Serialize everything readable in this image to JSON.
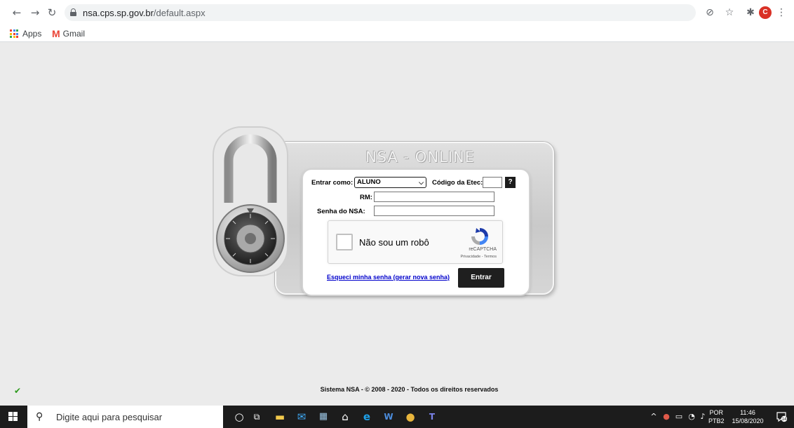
{
  "browser": {
    "url_host": "nsa.cps.sp.gov.br",
    "url_path": "/default.aspx",
    "profile_initial": "C",
    "bookmarks": [
      {
        "label": "Apps",
        "icon": "apps-grid-icon"
      },
      {
        "label": "Gmail",
        "icon": "gmail-icon"
      }
    ]
  },
  "login": {
    "title": "NSA - ONLINE",
    "enter_as_label": "Entrar como:",
    "enter_as_value": "ALUNO",
    "etec_code_label": "Código da Etec:",
    "etec_code_value": "",
    "help_label": "?",
    "rm_label": "RM:",
    "rm_value": "",
    "password_label": "Senha do NSA:",
    "password_value": "",
    "captcha_text": "Não sou um robô",
    "captcha_brand": "reCAPTCHA",
    "captcha_links": "Privacidade - Termos",
    "forgot_link": "Esqueci minha senha (gerar nova senha)",
    "submit_label": "Entrar"
  },
  "footer": {
    "text": "Sistema NSA  -  © 2008 - 2020  -  Todos os direitos reservados"
  },
  "taskbar": {
    "search_placeholder": "Digite aqui para pesquisar",
    "lang_top": "POR",
    "lang_bottom": "PTB2",
    "time": "11:46",
    "date": "15/08/2020",
    "notification_count": "14"
  },
  "colors": {
    "page_bg": "#ebebeb",
    "link": "#0000cc",
    "button": "#1f1f1f",
    "taskbar": "#1c1c1c"
  }
}
